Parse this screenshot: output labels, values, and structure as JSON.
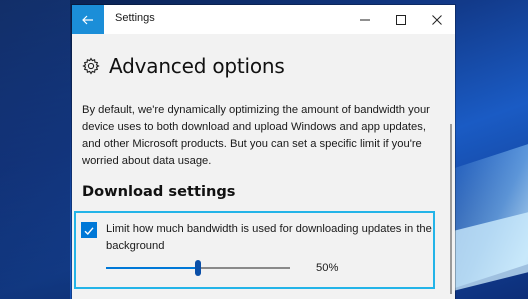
{
  "window": {
    "title": "Settings"
  },
  "titlebar": {
    "back_icon": "arrow-left-icon",
    "minimize_icon": "minimize-icon",
    "maximize_icon": "maximize-icon",
    "close_icon": "close-icon"
  },
  "page": {
    "title": "Advanced options",
    "title_icon": "gear-icon",
    "description": "By default, we're dynamically optimizing the amount of bandwidth your device uses to both download and upload Windows and app updates, and other Microsoft products. But you can set a specific limit if you're worried about data usage."
  },
  "download_settings": {
    "heading": "Download settings",
    "limit_checkbox": {
      "label": "Limit how much bandwidth is used for downloading updates in the background",
      "checked": true
    },
    "bandwidth_slider": {
      "value_percent": 50,
      "value_label": "50%"
    }
  },
  "colors": {
    "accent": "#0078d7",
    "back_button": "#1b8ed8",
    "highlight_border": "#23b4e8",
    "window_background": "#f2f2f2"
  }
}
